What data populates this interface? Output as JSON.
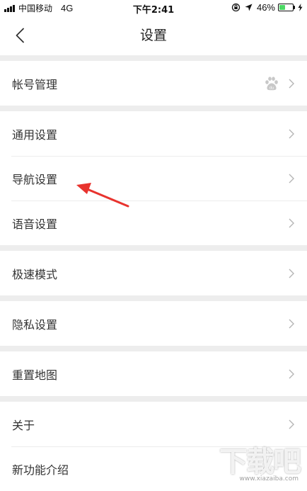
{
  "status_bar": {
    "carrier": "中国移动",
    "network": "4G",
    "time": "下午2:41",
    "battery_percent": "46%",
    "battery_level": 0.46,
    "icons": [
      "signal-icon",
      "orientation-lock-icon",
      "location-arrow-icon",
      "battery-icon",
      "charging-bolt-icon"
    ],
    "battery_color": "#4cd964"
  },
  "nav": {
    "title": "设置",
    "back_icon": "chevron-left-icon"
  },
  "sections": [
    {
      "items": [
        {
          "label": "帐号管理",
          "icon": "baidu-paw-icon"
        }
      ]
    },
    {
      "items": [
        {
          "label": "通用设置"
        },
        {
          "label": "导航设置"
        },
        {
          "label": "语音设置"
        }
      ]
    },
    {
      "items": [
        {
          "label": "极速模式"
        }
      ]
    },
    {
      "items": [
        {
          "label": "隐私设置"
        }
      ]
    },
    {
      "items": [
        {
          "label": "重置地图"
        }
      ]
    },
    {
      "items": [
        {
          "label": "关于"
        },
        {
          "label": "新功能介绍"
        }
      ]
    }
  ],
  "annotation": {
    "target": "导航设置",
    "color": "#e8332e"
  },
  "watermark": {
    "text": "下载吧",
    "url": "www.xiazaiba.com"
  }
}
